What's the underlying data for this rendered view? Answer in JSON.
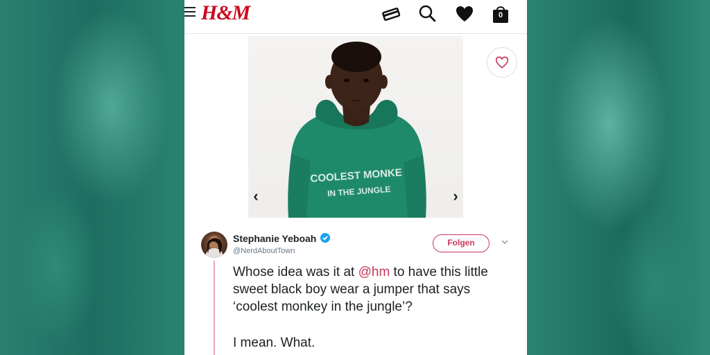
{
  "header": {
    "logo_text": "H&M",
    "bag_count": "0",
    "brand_color": "#cc071e"
  },
  "product": {
    "hoodie_print_line1": "COOLEST MONKE",
    "hoodie_print_line2": "IN THE JUNGLE",
    "hoodie_color": "#1f8a6a"
  },
  "tweet": {
    "author_name": "Stephanie Yeboah",
    "author_handle": "@NerdAboutTown",
    "follow_label": "Folgen",
    "text_before": "Whose idea was it at ",
    "mention": "@hm",
    "text_after": " to have this little sweet black boy wear a jumper that says ‘coolest monkey in the jungle’?",
    "text_line2": "I mean. What.",
    "accent_color": "#c8365a"
  }
}
